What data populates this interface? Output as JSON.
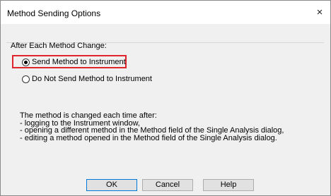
{
  "window": {
    "title": "Method Sending Options",
    "close_glyph": "×"
  },
  "group": {
    "label": "After Each Method Change:"
  },
  "options": [
    {
      "label": "Send Method to Instrument",
      "checked": true
    },
    {
      "label": "Do Not Send Method to Instrument",
      "checked": false
    }
  ],
  "info_lines": [
    "The method is changed each time after:",
    "- logging to the Instrument window,",
    "- opening a different method in the Method field of the Single Analysis dialog,",
    "- editing a method opened in the Method field of the Single Analysis dialog."
  ],
  "buttons": {
    "ok": "OK",
    "cancel": "Cancel",
    "help": "Help"
  },
  "colors": {
    "highlight": "#e0242d",
    "default_button_border": "#0078d7"
  }
}
